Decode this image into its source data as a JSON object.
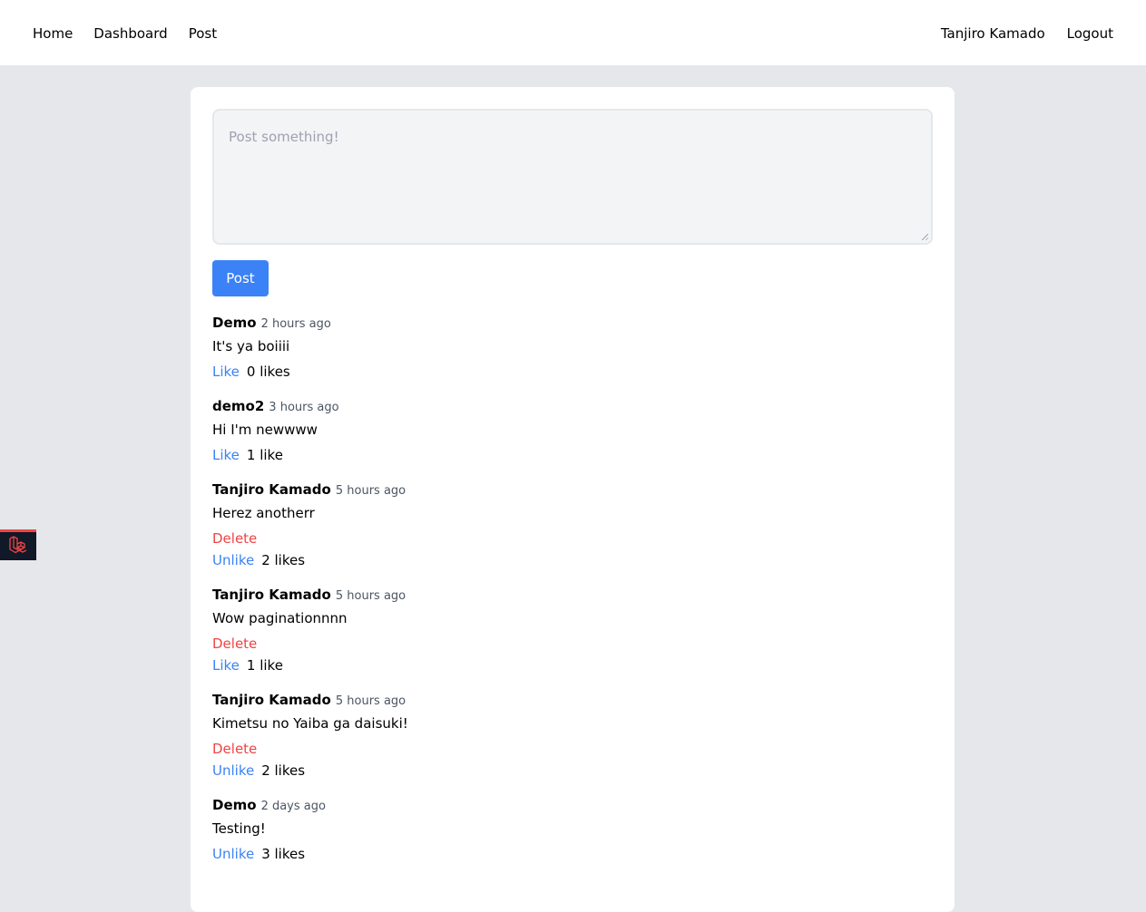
{
  "nav": {
    "left": [
      {
        "label": "Home"
      },
      {
        "label": "Dashboard"
      },
      {
        "label": "Post"
      }
    ],
    "right": [
      {
        "label": "Tanjiro Kamado"
      },
      {
        "label": "Logout"
      }
    ]
  },
  "composer": {
    "placeholder": "Post something!",
    "submit_label": "Post"
  },
  "posts": [
    {
      "author": "Demo",
      "time": "2 hours ago",
      "body": "It's ya boiiii",
      "delete_label": "",
      "like_label": "Like",
      "likes": "0 likes"
    },
    {
      "author": "demo2",
      "time": "3 hours ago",
      "body": "Hi I'm newwww",
      "delete_label": "",
      "like_label": "Like",
      "likes": "1 like"
    },
    {
      "author": "Tanjiro Kamado",
      "time": "5 hours ago",
      "body": "Herez anotherr",
      "delete_label": "Delete",
      "like_label": "Unlike",
      "likes": "2 likes"
    },
    {
      "author": "Tanjiro Kamado",
      "time": "5 hours ago",
      "body": "Wow paginationnnn",
      "delete_label": "Delete",
      "like_label": "Like",
      "likes": "1 like"
    },
    {
      "author": "Tanjiro Kamado",
      "time": "5 hours ago",
      "body": "Kimetsu no Yaiba ga daisuki!",
      "delete_label": "Delete",
      "like_label": "Unlike",
      "likes": "2 likes"
    },
    {
      "author": "Demo",
      "time": "2 days ago",
      "body": "Testing!",
      "delete_label": "",
      "like_label": "Unlike",
      "likes": "3 likes"
    }
  ],
  "colors": {
    "accent": "#3b82f6",
    "danger": "#ef4444",
    "background": "#e5e7eb"
  },
  "icons": {
    "debug_badge": "laravel-logo-icon"
  }
}
